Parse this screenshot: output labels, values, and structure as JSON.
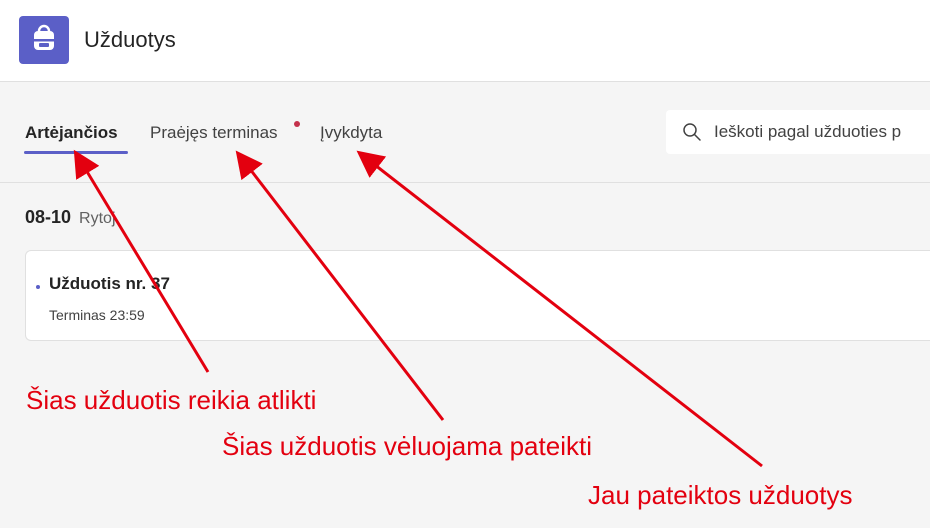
{
  "app": {
    "title": "Užduotys",
    "accent_color": "#5b5fc7",
    "icon": "backpack-icon"
  },
  "tabs": [
    {
      "label": "Artėjančios",
      "active": true
    },
    {
      "label": "Praėjęs terminas",
      "active": false,
      "has_notification": true
    },
    {
      "label": "Įvykdyta",
      "active": false
    }
  ],
  "search": {
    "placeholder": "Ieškoti pagal užduoties p",
    "icon": "search-icon"
  },
  "group": {
    "date": "08-10",
    "relative": "Rytoj"
  },
  "task": {
    "title": "Užduotis nr. 37",
    "due": "Terminas 23:59"
  },
  "annotations": {
    "color": "#e3000f",
    "upcoming": "Šias užduotis reikia atlikti",
    "overdue": "Šias užduotis vėluojama pateikti",
    "completed": "Jau pateiktos užduotys"
  }
}
